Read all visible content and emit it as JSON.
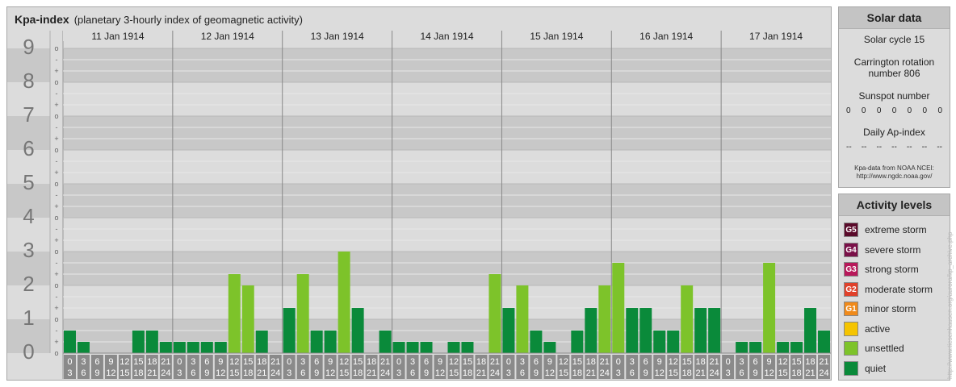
{
  "header": {
    "title": "Kpa-index",
    "subtitle": "(planetary 3-hourly index of geomagnetic activity)"
  },
  "chart_data": {
    "type": "bar",
    "title": "Kpa-index",
    "subtitle": "(planetary 3-hourly index of geomagnetic activity)",
    "ylim": [
      0,
      9
    ],
    "y_ticks": [
      "0",
      "1",
      "2",
      "3",
      "4",
      "5",
      "6",
      "7",
      "8",
      "9"
    ],
    "y_subticks": [
      "o",
      "+",
      "-",
      "o",
      "+",
      "-",
      "o",
      "+",
      "-",
      "o",
      "+",
      "-",
      "o",
      "+",
      "-",
      "o",
      "+",
      "-",
      "o",
      "+",
      "-",
      "o",
      "+",
      "-",
      "o",
      "+",
      "-",
      "o"
    ],
    "days": [
      {
        "label": "11 Jan 1914",
        "values": [
          0.667,
          0.333,
          0,
          0,
          0,
          0.667,
          0.667,
          0.333
        ],
        "colors": [
          "#0a8a3a",
          "#0a8a3a",
          "#0a8a3a",
          "#0a8a3a",
          "#0a8a3a",
          "#0a8a3a",
          "#0a8a3a",
          "#0a8a3a"
        ]
      },
      {
        "label": "12 Jan 1914",
        "values": [
          0.333,
          0.333,
          0.333,
          0.333,
          2.333,
          2.0,
          0.667,
          0
        ],
        "colors": [
          "#0a8a3a",
          "#0a8a3a",
          "#0a8a3a",
          "#0a8a3a",
          "#7dc32a",
          "#7dc32a",
          "#0a8a3a",
          "#0a8a3a"
        ]
      },
      {
        "label": "13 Jan 1914",
        "values": [
          1.333,
          2.333,
          0.667,
          0.667,
          3.0,
          1.333,
          0,
          0.667
        ],
        "colors": [
          "#0a8a3a",
          "#7dc32a",
          "#0a8a3a",
          "#0a8a3a",
          "#7dc32a",
          "#0a8a3a",
          "#0a8a3a",
          "#0a8a3a"
        ]
      },
      {
        "label": "14 Jan 1914",
        "values": [
          0.333,
          0.333,
          0.333,
          0,
          0.333,
          0.333,
          0,
          2.333
        ],
        "colors": [
          "#0a8a3a",
          "#0a8a3a",
          "#0a8a3a",
          "#0a8a3a",
          "#0a8a3a",
          "#0a8a3a",
          "#0a8a3a",
          "#7dc32a"
        ]
      },
      {
        "label": "15 Jan 1914",
        "values": [
          1.333,
          2.0,
          0.667,
          0.333,
          0,
          0.667,
          1.333,
          2.0
        ],
        "colors": [
          "#0a8a3a",
          "#7dc32a",
          "#0a8a3a",
          "#0a8a3a",
          "#0a8a3a",
          "#0a8a3a",
          "#0a8a3a",
          "#7dc32a"
        ]
      },
      {
        "label": "16 Jan 1914",
        "values": [
          2.667,
          1.333,
          1.333,
          0.667,
          0.667,
          2.0,
          1.333,
          1.333
        ],
        "colors": [
          "#7dc32a",
          "#0a8a3a",
          "#0a8a3a",
          "#0a8a3a",
          "#0a8a3a",
          "#7dc32a",
          "#0a8a3a",
          "#0a8a3a"
        ]
      },
      {
        "label": "17 Jan 1914",
        "values": [
          0,
          0.333,
          0.333,
          2.667,
          0.333,
          0.333,
          1.333,
          0.667
        ],
        "colors": [
          "#0a8a3a",
          "#0a8a3a",
          "#0a8a3a",
          "#7dc32a",
          "#0a8a3a",
          "#0a8a3a",
          "#0a8a3a",
          "#0a8a3a"
        ]
      }
    ],
    "hour_starts": [
      "0",
      "3",
      "6",
      "9",
      "12",
      "15",
      "18",
      "21"
    ],
    "hour_ends": [
      "3",
      "6",
      "9",
      "12",
      "15",
      "18",
      "21",
      "24"
    ]
  },
  "solar": {
    "title": "Solar data",
    "cycle": "Solar cycle 15",
    "carrington_1": "Carrington rotation",
    "carrington_2": "number 806",
    "sunspot_label": "Sunspot number",
    "sunspot_values": [
      "0",
      "0",
      "0",
      "0",
      "0",
      "0",
      "0"
    ],
    "ap_label": "Daily Ap-index",
    "ap_values": [
      "--",
      "--",
      "--",
      "--",
      "--",
      "--",
      "--"
    ],
    "source_1": "Kpa-data from NOAA NCEI:",
    "source_2": "http://www.ngdc.noaa.gov/"
  },
  "levels": {
    "title": "Activity levels",
    "items": [
      {
        "badge": "G5",
        "label": "extreme storm",
        "color": "#5a0a2a"
      },
      {
        "badge": "G4",
        "label": "severe storm",
        "color": "#7a1048"
      },
      {
        "badge": "G3",
        "label": "strong storm",
        "color": "#b8185a"
      },
      {
        "badge": "G2",
        "label": "moderate storm",
        "color": "#e0402a"
      },
      {
        "badge": "G1",
        "label": "minor storm",
        "color": "#f08a1a"
      },
      {
        "badge": "",
        "label": "active",
        "color": "#f5c400"
      },
      {
        "badge": "",
        "label": "unsettled",
        "color": "#7dc32a"
      },
      {
        "badge": "",
        "label": "quiet",
        "color": "#0a8a3a"
      }
    ]
  },
  "watermark": "http://www.tiesenhausen.org/aurora/kp_archive.php"
}
